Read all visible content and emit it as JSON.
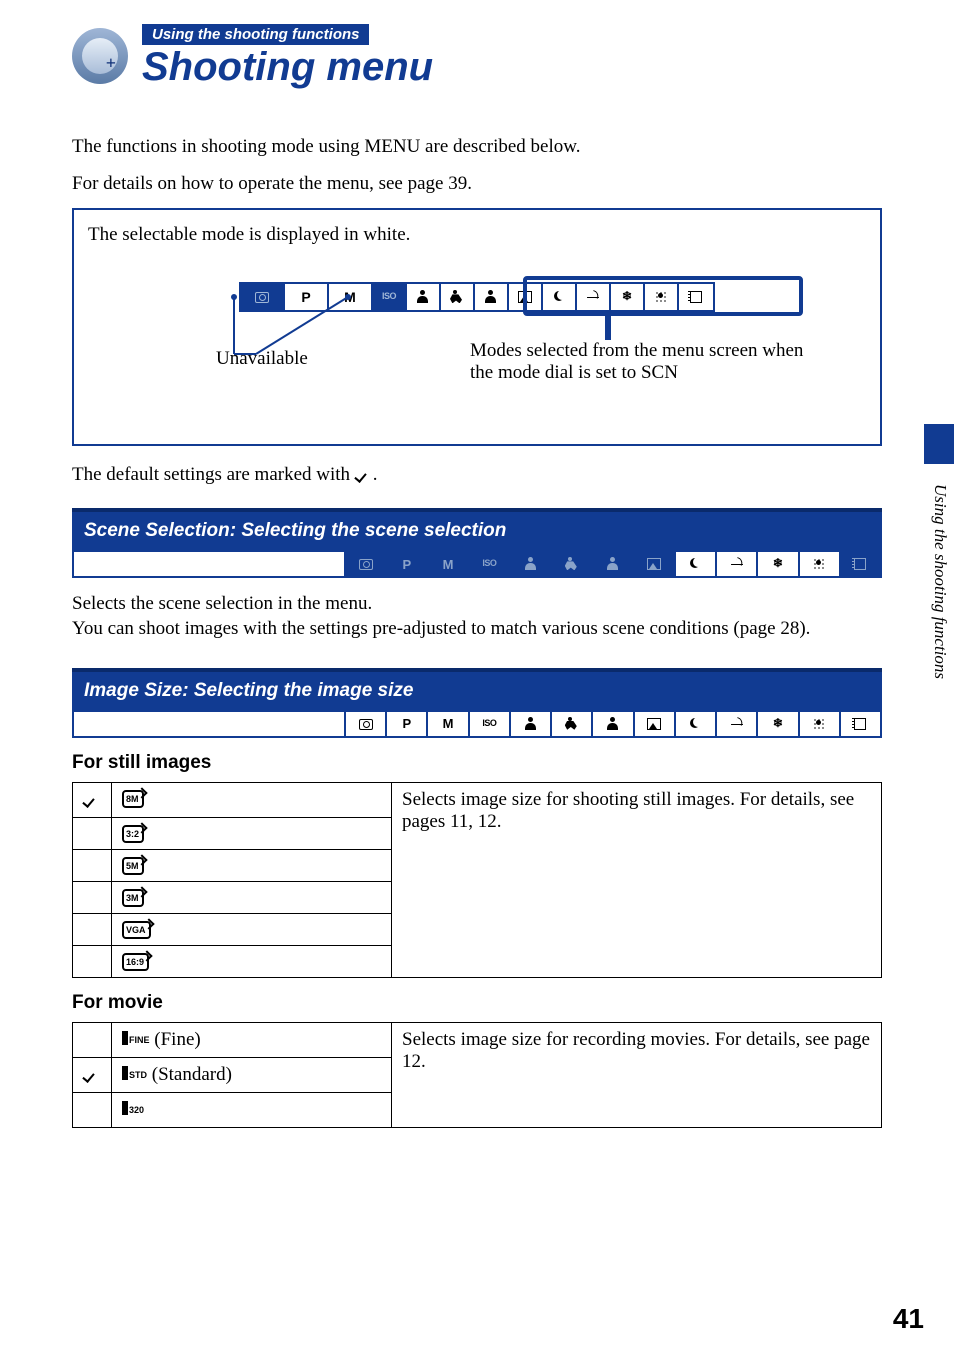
{
  "header": {
    "chapter": "Using the shooting functions",
    "title": "Shooting menu"
  },
  "intro": {
    "line1": "The functions in shooting mode using MENU are described below.",
    "line2": "For details on how to operate the menu, see page 39."
  },
  "mode_box": {
    "caption": "The selectable mode is displayed in white.",
    "unavailable_label": "Unavailable",
    "scn_label": "Modes selected from the menu screen when the mode dial is set to SCN",
    "strip": [
      {
        "name": "auto-icon",
        "glyph": "g-cam",
        "avail": false,
        "wide": true
      },
      {
        "name": "p-mode",
        "text": "P",
        "avail": true,
        "wide": true
      },
      {
        "name": "m-mode",
        "text": "M",
        "avail": true,
        "wide": true
      },
      {
        "name": "iso-mode",
        "glyph_text": "ISO",
        "avail": false
      },
      {
        "name": "portrait-icon",
        "glyph": "g-person",
        "avail": true
      },
      {
        "name": "sports-icon",
        "glyph": "g-run",
        "avail": true
      },
      {
        "name": "twilight-portrait-icon",
        "glyph": "g-person",
        "avail": true
      },
      {
        "name": "landscape-icon",
        "glyph": "g-land",
        "avail": true
      },
      {
        "name": "twilight-icon",
        "glyph": "g-moon",
        "avail": true
      },
      {
        "name": "beach-icon",
        "glyph": "g-beach",
        "avail": true
      },
      {
        "name": "snow-icon",
        "glyph": "g-snow",
        "avail": true
      },
      {
        "name": "fireworks-icon",
        "glyph": "g-fire",
        "avail": true
      },
      {
        "name": "movie-icon",
        "glyph": "g-film",
        "avail": true
      }
    ]
  },
  "default_text_pre": "The default settings are marked with ",
  "default_text_post": ".",
  "scene_section": {
    "bar": "Scene Selection: Selecting the scene selection",
    "strip": [
      {
        "name": "auto-icon",
        "glyph": "g-cam",
        "avail": false
      },
      {
        "name": "p-mode",
        "text": "P",
        "avail": false
      },
      {
        "name": "m-mode",
        "text": "M",
        "avail": false
      },
      {
        "name": "iso-mode",
        "glyph_text": "ISO",
        "avail": false
      },
      {
        "name": "portrait-icon",
        "glyph": "g-person",
        "avail": false
      },
      {
        "name": "sports-icon",
        "glyph": "g-run",
        "avail": false
      },
      {
        "name": "twilight-portrait-icon",
        "glyph": "g-person",
        "avail": false
      },
      {
        "name": "landscape-icon",
        "glyph": "g-land",
        "avail": false
      },
      {
        "name": "twilight-icon",
        "glyph": "g-moon",
        "avail": true
      },
      {
        "name": "beach-icon",
        "glyph": "g-beach",
        "avail": true
      },
      {
        "name": "snow-icon",
        "glyph": "g-snow",
        "avail": true
      },
      {
        "name": "fireworks-icon",
        "glyph": "g-fire",
        "avail": true
      },
      {
        "name": "movie-icon",
        "glyph": "g-film",
        "avail": false
      }
    ],
    "body": "Selects the scene selection in the menu.\nYou can shoot images with the settings pre-adjusted to match various scene conditions (page 28)."
  },
  "image_size_section": {
    "bar": "Image Size: Selecting the image size",
    "strip": [
      {
        "name": "auto-icon",
        "glyph": "g-cam",
        "avail": true
      },
      {
        "name": "p-mode",
        "text": "P",
        "avail": true
      },
      {
        "name": "m-mode",
        "text": "M",
        "avail": true
      },
      {
        "name": "iso-mode",
        "glyph_text": "ISO",
        "avail": true
      },
      {
        "name": "portrait-icon",
        "glyph": "g-person",
        "avail": true
      },
      {
        "name": "sports-icon",
        "glyph": "g-run",
        "avail": true
      },
      {
        "name": "twilight-portrait-icon",
        "glyph": "g-person",
        "avail": true
      },
      {
        "name": "landscape-icon",
        "glyph": "g-land",
        "avail": true
      },
      {
        "name": "twilight-icon",
        "glyph": "g-moon",
        "avail": true
      },
      {
        "name": "beach-icon",
        "glyph": "g-beach",
        "avail": true
      },
      {
        "name": "snow-icon",
        "glyph": "g-snow",
        "avail": true
      },
      {
        "name": "fireworks-icon",
        "glyph": "g-fire",
        "avail": true
      },
      {
        "name": "movie-icon",
        "glyph": "g-film",
        "avail": true
      }
    ],
    "still_head": "For still images",
    "still_rows": [
      {
        "default": true,
        "icon": "8M"
      },
      {
        "default": false,
        "icon": "3:2"
      },
      {
        "default": false,
        "icon": "5M"
      },
      {
        "default": false,
        "icon": "3M"
      },
      {
        "default": false,
        "icon": "VGA"
      },
      {
        "default": false,
        "icon": "16:9"
      }
    ],
    "still_desc": "Selects image size for shooting still images. For details, see pages 11, 12.",
    "movie_head": "For movie",
    "movie_rows": [
      {
        "default": false,
        "icon": "FINE",
        "suffix": " (Fine)"
      },
      {
        "default": true,
        "icon": "STD",
        "suffix": " (Standard)"
      },
      {
        "default": false,
        "icon": "320",
        "suffix": ""
      }
    ],
    "movie_desc": "Selects image size for recording movies. For details, see page 12."
  },
  "side_tab": "Using the shooting functions",
  "page_number": "41"
}
